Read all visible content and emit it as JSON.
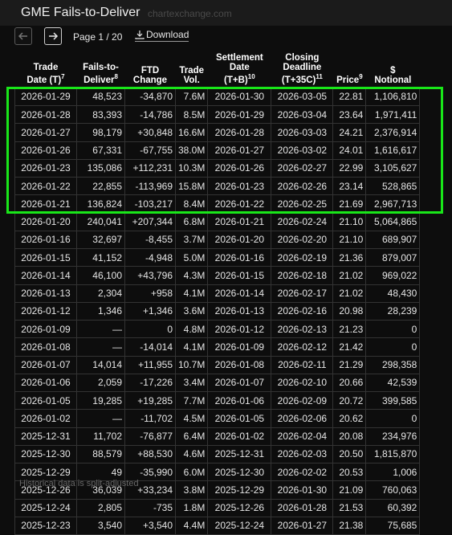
{
  "header": {
    "title": "GME Fails-to-Deliver",
    "watermark": "chartexchange.com"
  },
  "pager": {
    "page_label": "Page 1 / 20",
    "download_label": "Download"
  },
  "columns": [
    {
      "l1": "Trade",
      "l2": "Date (T)",
      "sup": "7"
    },
    {
      "l1": "Fails-to-",
      "l2": "Deliver",
      "sup": "8"
    },
    {
      "l1": "FTD",
      "l2": "Change",
      "sup": ""
    },
    {
      "l1": "Trade",
      "l2": "Vol.",
      "sup": ""
    },
    {
      "l0": "Settlement",
      "l1": "Date",
      "l2": "(T+B)",
      "sup": "10"
    },
    {
      "l0": "Closing",
      "l1": "Deadline",
      "l2": "(T+35C)",
      "sup": "11"
    },
    {
      "l1": "",
      "l2": "Price",
      "sup": "9"
    },
    {
      "l1": "$",
      "l2": "Notional",
      "sup": ""
    }
  ],
  "rows": [
    [
      "2026-01-29",
      "48,523",
      "-34,870",
      "7.6M",
      "2026-01-30",
      "2026-03-05",
      "22.81",
      "1,106,810"
    ],
    [
      "2026-01-28",
      "83,393",
      "-14,786",
      "8.5M",
      "2026-01-29",
      "2026-03-04",
      "23.64",
      "1,971,411"
    ],
    [
      "2026-01-27",
      "98,179",
      "+30,848",
      "16.6M",
      "2026-01-28",
      "2026-03-03",
      "24.21",
      "2,376,914"
    ],
    [
      "2026-01-26",
      "67,331",
      "-67,755",
      "38.0M",
      "2026-01-27",
      "2026-03-02",
      "24.01",
      "1,616,617"
    ],
    [
      "2026-01-23",
      "135,086",
      "+112,231",
      "10.3M",
      "2026-01-26",
      "2026-02-27",
      "22.99",
      "3,105,627"
    ],
    [
      "2026-01-22",
      "22,855",
      "-113,969",
      "15.8M",
      "2026-01-23",
      "2026-02-26",
      "23.14",
      "528,865"
    ],
    [
      "2026-01-21",
      "136,824",
      "-103,217",
      "8.4M",
      "2026-01-22",
      "2026-02-25",
      "21.69",
      "2,967,713"
    ],
    [
      "2026-01-20",
      "240,041",
      "+207,344",
      "6.8M",
      "2026-01-21",
      "2026-02-24",
      "21.10",
      "5,064,865"
    ],
    [
      "2026-01-16",
      "32,697",
      "-8,455",
      "3.7M",
      "2026-01-20",
      "2026-02-20",
      "21.10",
      "689,907"
    ],
    [
      "2026-01-15",
      "41,152",
      "-4,948",
      "5.0M",
      "2026-01-16",
      "2026-02-19",
      "21.36",
      "879,007"
    ],
    [
      "2026-01-14",
      "46,100",
      "+43,796",
      "4.3M",
      "2026-01-15",
      "2026-02-18",
      "21.02",
      "969,022"
    ],
    [
      "2026-01-13",
      "2,304",
      "+958",
      "4.1M",
      "2026-01-14",
      "2026-02-17",
      "21.02",
      "48,430"
    ],
    [
      "2026-01-12",
      "1,346",
      "+1,346",
      "3.6M",
      "2026-01-13",
      "2026-02-16",
      "20.98",
      "28,239"
    ],
    [
      "2026-01-09",
      "—",
      "0",
      "4.8M",
      "2026-01-12",
      "2026-02-13",
      "21.23",
      "0"
    ],
    [
      "2026-01-08",
      "—",
      "-14,014",
      "4.1M",
      "2026-01-09",
      "2026-02-12",
      "21.42",
      "0"
    ],
    [
      "2026-01-07",
      "14,014",
      "+11,955",
      "10.7M",
      "2026-01-08",
      "2026-02-11",
      "21.29",
      "298,358"
    ],
    [
      "2026-01-06",
      "2,059",
      "-17,226",
      "3.4M",
      "2026-01-07",
      "2026-02-10",
      "20.66",
      "42,539"
    ],
    [
      "2026-01-05",
      "19,285",
      "+19,285",
      "7.7M",
      "2026-01-06",
      "2026-02-09",
      "20.72",
      "399,585"
    ],
    [
      "2026-01-02",
      "—",
      "-11,702",
      "4.5M",
      "2026-01-05",
      "2026-02-06",
      "20.62",
      "0"
    ],
    [
      "2025-12-31",
      "11,702",
      "-76,877",
      "6.4M",
      "2026-01-02",
      "2026-02-04",
      "20.08",
      "234,976"
    ],
    [
      "2025-12-30",
      "88,579",
      "+88,530",
      "4.6M",
      "2025-12-31",
      "2026-02-03",
      "20.50",
      "1,815,870"
    ],
    [
      "2025-12-29",
      "49",
      "-35,990",
      "6.0M",
      "2025-12-30",
      "2026-02-02",
      "20.53",
      "1,006"
    ],
    [
      "2025-12-26",
      "36,039",
      "+33,234",
      "3.8M",
      "2025-12-29",
      "2026-01-30",
      "21.09",
      "760,063"
    ],
    [
      "2025-12-24",
      "2,805",
      "-735",
      "1.8M",
      "2025-12-26",
      "2026-01-28",
      "21.53",
      "60,392"
    ],
    [
      "2025-12-23",
      "3,540",
      "+3,540",
      "4.4M",
      "2025-12-24",
      "2026-01-27",
      "21.38",
      "75,685"
    ]
  ],
  "footnote": "Historical data is split-adjusted",
  "colors": {
    "highlight": "#19e619",
    "background": "#0d0d0d",
    "grid": "#333333"
  }
}
